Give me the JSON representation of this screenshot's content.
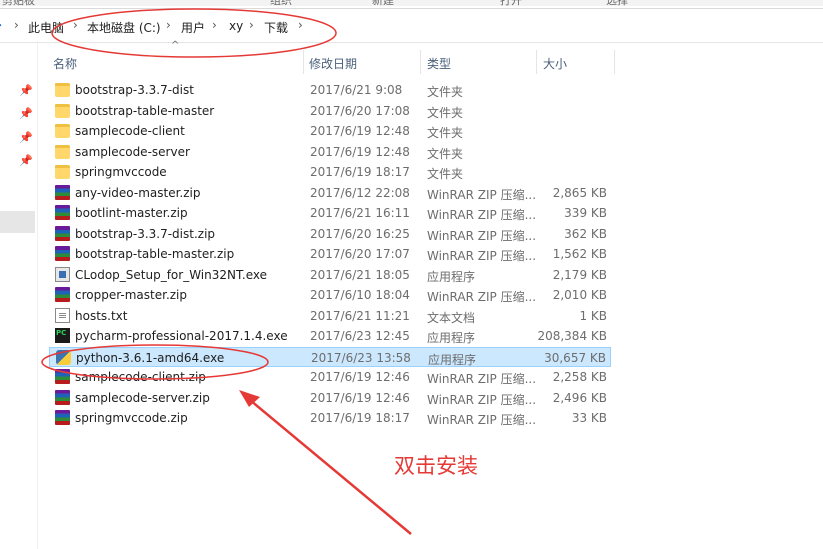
{
  "ribbon": {
    "groups": [
      "剪贴板",
      "组织",
      "新建",
      "打开",
      "选择"
    ]
  },
  "address": {
    "crumbs": [
      "此电脑",
      "本地磁盘 (C:)",
      "用户",
      "xy",
      "下载"
    ],
    "separator": "›",
    "end_separator": "›"
  },
  "columns": {
    "name": "名称",
    "date": "修改日期",
    "type": "类型",
    "size": "大小"
  },
  "files": [
    {
      "name": "bootstrap-3.3.7-dist",
      "date": "2017/6/21 9:08",
      "type": "文件夹",
      "size": "",
      "icon": "folder-icon"
    },
    {
      "name": "bootstrap-table-master",
      "date": "2017/6/20 17:08",
      "type": "文件夹",
      "size": "",
      "icon": "folder-icon"
    },
    {
      "name": "samplecode-client",
      "date": "2017/6/19 12:48",
      "type": "文件夹",
      "size": "",
      "icon": "folder-icon"
    },
    {
      "name": "samplecode-server",
      "date": "2017/6/19 12:48",
      "type": "文件夹",
      "size": "",
      "icon": "folder-icon"
    },
    {
      "name": "springmvccode",
      "date": "2017/6/19 18:17",
      "type": "文件夹",
      "size": "",
      "icon": "folder-icon"
    },
    {
      "name": "any-video-master.zip",
      "date": "2017/6/12 22:08",
      "type": "WinRAR ZIP 压缩...",
      "size": "2,865 KB",
      "icon": "winrar-zip-icon"
    },
    {
      "name": "bootlint-master.zip",
      "date": "2017/6/21 16:11",
      "type": "WinRAR ZIP 压缩...",
      "size": "339 KB",
      "icon": "winrar-zip-icon"
    },
    {
      "name": "bootstrap-3.3.7-dist.zip",
      "date": "2017/6/20 16:25",
      "type": "WinRAR ZIP 压缩...",
      "size": "362 KB",
      "icon": "winrar-zip-icon"
    },
    {
      "name": "bootstrap-table-master.zip",
      "date": "2017/6/20 17:07",
      "type": "WinRAR ZIP 压缩...",
      "size": "1,562 KB",
      "icon": "winrar-zip-icon"
    },
    {
      "name": "CLodop_Setup_for_Win32NT.exe",
      "date": "2017/6/21 18:05",
      "type": "应用程序",
      "size": "2,179 KB",
      "icon": "installer-icon"
    },
    {
      "name": "cropper-master.zip",
      "date": "2017/6/10 18:04",
      "type": "WinRAR ZIP 压缩...",
      "size": "2,010 KB",
      "icon": "winrar-zip-icon"
    },
    {
      "name": "hosts.txt",
      "date": "2017/6/21 11:21",
      "type": "文本文档",
      "size": "1 KB",
      "icon": "text-file-icon"
    },
    {
      "name": "pycharm-professional-2017.1.4.exe",
      "date": "2017/6/23 12:45",
      "type": "应用程序",
      "size": "208,384 KB",
      "icon": "pycharm-icon"
    },
    {
      "name": "python-3.6.1-amd64.exe",
      "date": "2017/6/23 13:58",
      "type": "应用程序",
      "size": "30,657 KB",
      "icon": "python-installer-icon",
      "selected": true
    },
    {
      "name": "samplecode-client.zip",
      "date": "2017/6/19 12:46",
      "type": "WinRAR ZIP 压缩...",
      "size": "2,258 KB",
      "icon": "winrar-zip-icon"
    },
    {
      "name": "samplecode-server.zip",
      "date": "2017/6/19 12:46",
      "type": "WinRAR ZIP 压缩...",
      "size": "2,496 KB",
      "icon": "winrar-zip-icon"
    },
    {
      "name": "springmvccode.zip",
      "date": "2017/6/19 18:17",
      "type": "WinRAR ZIP 压缩...",
      "size": "33 KB",
      "icon": "winrar-zip-icon"
    }
  ],
  "annotation": {
    "caption": "双击安装",
    "color": "#e53935"
  },
  "colors": {
    "selection_bg": "#cce8ff",
    "selection_border": "#99d1ff",
    "header_text": "#4c607a"
  }
}
